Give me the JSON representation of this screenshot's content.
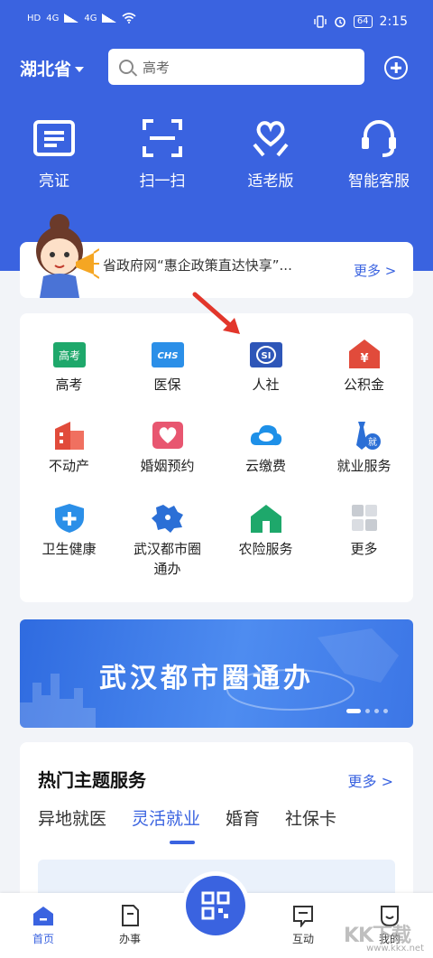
{
  "status_bar": {
    "left_indicators": [
      "HD",
      "4G",
      "4G"
    ],
    "battery": "64",
    "time": "2:15"
  },
  "header": {
    "province": "湖北省",
    "search_placeholder": "高考"
  },
  "quick_actions": [
    {
      "label": "亮证",
      "icon": "id-card-icon"
    },
    {
      "label": "扫一扫",
      "icon": "scan-icon"
    },
    {
      "label": "适老版",
      "icon": "elder-heart-icon"
    },
    {
      "label": "智能客服",
      "icon": "headset-icon"
    }
  ],
  "notice": {
    "text": "省政府网“惠企政策直达快享”...",
    "more": "更多 >"
  },
  "services": [
    {
      "label": "高考",
      "icon": "gaokao-icon"
    },
    {
      "label": "医保",
      "icon": "medical-insurance-icon"
    },
    {
      "label": "人社",
      "icon": "social-security-icon"
    },
    {
      "label": "公积金",
      "icon": "housing-fund-icon"
    },
    {
      "label": "不动产",
      "icon": "real-estate-icon"
    },
    {
      "label": "婚姻预约",
      "icon": "marriage-icon"
    },
    {
      "label": "云缴费",
      "icon": "cloud-payment-icon"
    },
    {
      "label": "就业服务",
      "icon": "employment-icon"
    },
    {
      "label": "卫生健康",
      "icon": "health-shield-icon"
    },
    {
      "label": "武汉都市圈\n通办",
      "icon": "wuhan-map-icon"
    },
    {
      "label": "农险服务",
      "icon": "farm-house-icon"
    },
    {
      "label": "更多",
      "icon": "more-grid-icon"
    }
  ],
  "banner": {
    "title": "武汉都市圈通办"
  },
  "hot_topics": {
    "title": "热门主题服务",
    "more": "更多 >",
    "tabs": [
      "异地就医",
      "灵活就业",
      "婚育",
      "社保卡"
    ],
    "active_tab": "灵活就业"
  },
  "bottom_nav": [
    {
      "label": "首页",
      "icon": "home-icon",
      "active": true
    },
    {
      "label": "办事",
      "icon": "document-icon",
      "active": false
    },
    {
      "label": "互动",
      "icon": "chat-icon",
      "active": false
    },
    {
      "label": "我的",
      "icon": "user-icon",
      "active": false
    }
  ],
  "watermark": {
    "text": "KK下载",
    "sub": "www.kkx.net"
  },
  "colors": {
    "primary": "#3a63e0",
    "background": "#f2f4f8",
    "arrow": "#e2362b"
  }
}
